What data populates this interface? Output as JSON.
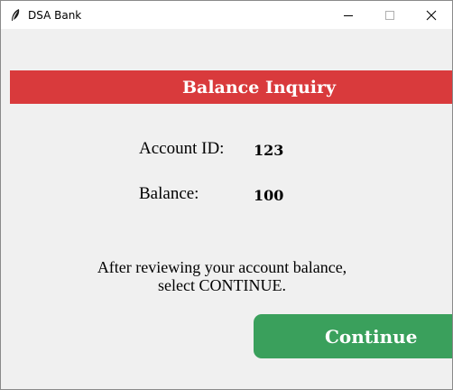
{
  "window": {
    "title": "DSA Bank",
    "icons": {
      "app": "feather-icon",
      "minimize": "minimize-icon",
      "maximize": "maximize-icon",
      "close": "close-icon"
    }
  },
  "header": {
    "title": "Balance Inquiry",
    "color": "#d93a3c"
  },
  "account": {
    "id_label": "Account ID:",
    "id_value": "123",
    "balance_label": "Balance:",
    "balance_value": "100"
  },
  "instruction": {
    "line1": "After reviewing your account balance,",
    "line2": "select CONTINUE."
  },
  "actions": {
    "continue_label": "Continue",
    "continue_color": "#3aa05c"
  }
}
